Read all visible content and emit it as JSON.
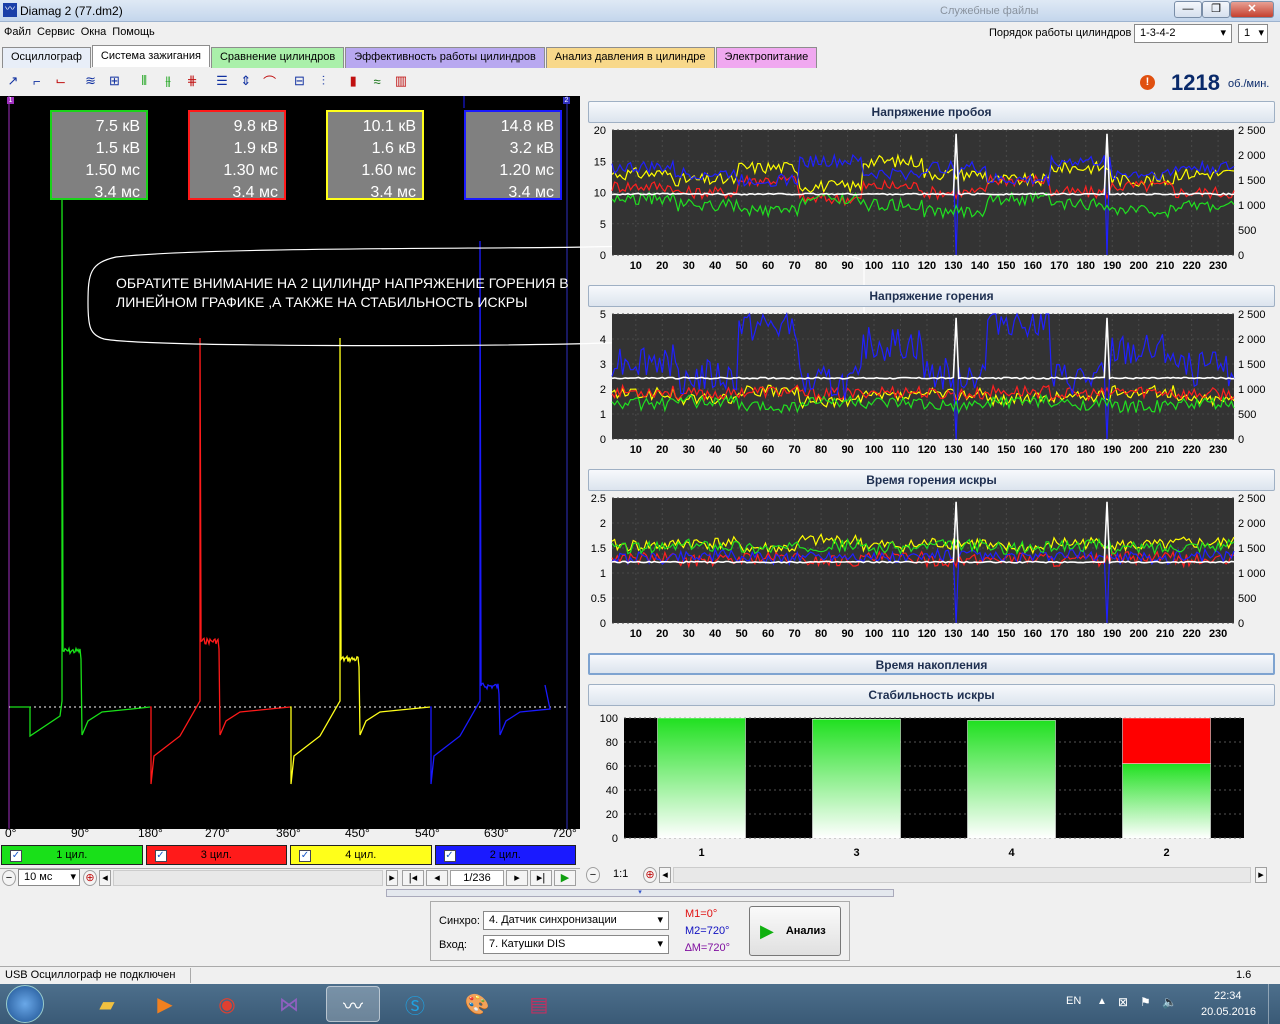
{
  "window": {
    "title": "Diamag 2 (77.dm2)",
    "ghost_tab": "Служебные файлы"
  },
  "menu": [
    "Файл",
    "Сервис",
    "Окна",
    "Помощь"
  ],
  "firing_order": {
    "label": "Порядок работы цилиндров",
    "value": "1-3-4-2",
    "spinner": "1"
  },
  "tabs": [
    {
      "label": "Осциллограф",
      "color": "#e8eef8"
    },
    {
      "label": "Система зажигания",
      "color": "#ffffff"
    },
    {
      "label": "Сравнение цилиндров",
      "color": "#aaf0aa"
    },
    {
      "label": "Эффективность работы цилиндров",
      "color": "#b8a8f0"
    },
    {
      "label": "Анализ давления в цилиндре",
      "color": "#f8d88a"
    },
    {
      "label": "Электропитание",
      "color": "#f0a8f0"
    }
  ],
  "rpm": {
    "value": "1218",
    "unit": "об./мин."
  },
  "readouts": [
    {
      "lines": [
        "7.5 кВ",
        "1.5 кВ",
        "1.50 мс",
        "3.4 мс"
      ],
      "color": "#19d419"
    },
    {
      "lines": [
        "9.8 кВ",
        "1.9 кВ",
        "1.30 мс",
        "3.4 мс"
      ],
      "color": "#ff1a1a"
    },
    {
      "lines": [
        "10.1 кВ",
        "1.6 кВ",
        "1.60 мс",
        "3.4 мс"
      ],
      "color": "#ffff1a"
    },
    {
      "lines": [
        "14.8 кВ",
        "3.2 кВ",
        "1.20 мс",
        "3.4 мс"
      ],
      "color": "#1a1aff"
    }
  ],
  "marker_labels": [
    "1",
    "2"
  ],
  "callout": "ОБРАТИТЕ ВНИМАНИЕ НА 2 ЦИЛИНДР НАПРЯЖЕНИЕ ГОРЕНИЯ В ЛИНЕЙНОМ ГРАФИКЕ ,А ТАКЖЕ НА СТАБИЛЬНОСТЬ ИСКРЫ",
  "deg_labels": [
    "0°",
    "90°",
    "180°",
    "270°",
    "360°",
    "450°",
    "540°",
    "630°",
    "720°"
  ],
  "cylinders": [
    {
      "label": "1 цил.",
      "color": "#19e019"
    },
    {
      "label": "3 цил.",
      "color": "#ff1a1a"
    },
    {
      "label": "4 цил.",
      "color": "#ffff1a"
    },
    {
      "label": "2 цил.",
      "color": "#1a1aff"
    }
  ],
  "nav": {
    "timebase": "10 мс",
    "frame": "1/236",
    "zoom": "1:1"
  },
  "panels": {
    "breakdown": "Напряжение пробоя",
    "burn_voltage": "Напряжение горения",
    "burn_time": "Время горения искры",
    "dwell": "Время накопления",
    "stability": "Стабильность искры"
  },
  "line_charts": {
    "x_ticks": [
      "10",
      "20",
      "30",
      "40",
      "50",
      "60",
      "70",
      "80",
      "90",
      "100",
      "110",
      "120",
      "130",
      "140",
      "150",
      "160",
      "170",
      "180",
      "190",
      "200",
      "210",
      "220",
      "230"
    ],
    "rpm_ticks": [
      "2 500",
      "2 000",
      "1 500",
      "1 000",
      "500",
      "0"
    ],
    "breakdown_y": [
      "20",
      "15",
      "10",
      "5",
      "0"
    ],
    "burn_voltage_y": [
      "5",
      "4",
      "3",
      "2",
      "1",
      "0"
    ],
    "burn_time_y": [
      "2.5",
      "2",
      "1.5",
      "1",
      "0.5",
      "0"
    ]
  },
  "chart_data": [
    {
      "type": "line",
      "title": "Напряжение пробоя",
      "x_range": [
        1,
        236
      ],
      "ylim": [
        0,
        20
      ],
      "y2lim": [
        0,
        2500
      ],
      "series": [
        {
          "values": [
            13,
            12,
            14,
            11,
            15,
            13,
            12,
            14,
            12,
            13
          ],
          "color": "#ffff00"
        },
        {
          "values": [
            11,
            10,
            12,
            9,
            11,
            10,
            12,
            10,
            11,
            10
          ],
          "color": "#ff2020"
        },
        {
          "values": [
            14,
            13,
            12,
            15,
            13,
            14,
            12,
            15,
            13,
            14
          ],
          "color": "#2020ff"
        },
        {
          "values": [
            9,
            8,
            7,
            9,
            8,
            7,
            9,
            8,
            7,
            8
          ],
          "color": "#20e020"
        },
        {
          "values": [
            1218,
            1218,
            1218,
            1218,
            1218,
            1218,
            1218,
            1218,
            1218,
            1218
          ],
          "color": "#ffffff",
          "axis": "rpm"
        }
      ]
    },
    {
      "type": "line",
      "title": "Напряжение горения",
      "x_range": [
        1,
        236
      ],
      "ylim": [
        0,
        5
      ],
      "y2lim": [
        0,
        2500
      ],
      "series": [
        {
          "values": [
            1.8,
            1.6,
            1.9,
            1.5,
            1.7,
            1.8,
            1.6,
            1.7,
            1.9,
            1.6
          ],
          "color": "#ffff00"
        },
        {
          "values": [
            1.9,
            1.8,
            1.9,
            1.8,
            1.9,
            1.8,
            1.9,
            1.8,
            1.9,
            1.8
          ],
          "color": "#ff2020"
        },
        {
          "values": [
            3.2,
            2.5,
            4.5,
            2.2,
            3.8,
            2.6,
            4.8,
            2.4,
            3.5,
            2.8
          ],
          "color": "#2020ff"
        },
        {
          "values": [
            1.4,
            1.5,
            1.3,
            1.5,
            1.4,
            1.3,
            1.5,
            1.4,
            1.3,
            1.4
          ],
          "color": "#20e020"
        },
        {
          "values": [
            1218,
            1218,
            1218,
            1218,
            1218,
            1218,
            1218,
            1218,
            1218,
            1218
          ],
          "color": "#ffffff",
          "axis": "rpm"
        }
      ]
    },
    {
      "type": "line",
      "title": "Время горения искры",
      "x_range": [
        1,
        236
      ],
      "ylim": [
        0,
        2.5
      ],
      "y2lim": [
        0,
        2500
      ],
      "series": [
        {
          "values": [
            1.55,
            1.6,
            1.5,
            1.65,
            1.55,
            1.6,
            1.5,
            1.6,
            1.55,
            1.6
          ],
          "color": "#ffff00"
        },
        {
          "values": [
            1.3,
            1.25,
            1.3,
            1.25,
            1.3,
            1.25,
            1.3,
            1.25,
            1.3,
            1.25
          ],
          "color": "#ff2020"
        },
        {
          "values": [
            1.3,
            1.35,
            1.3,
            1.35,
            1.3,
            1.35,
            1.3,
            1.35,
            1.3,
            1.35
          ],
          "color": "#2020ff"
        },
        {
          "values": [
            1.5,
            1.55,
            1.5,
            1.55,
            1.5,
            1.55,
            1.5,
            1.55,
            1.5,
            1.55
          ],
          "color": "#20e020"
        },
        {
          "values": [
            1218,
            1218,
            1218,
            1218,
            1218,
            1218,
            1218,
            1218,
            1218,
            1218
          ],
          "color": "#ffffff",
          "axis": "rpm"
        }
      ]
    },
    {
      "type": "bar",
      "title": "Стабильность искры",
      "categories": [
        "1",
        "3",
        "4",
        "2"
      ],
      "ylim": [
        0,
        100
      ],
      "y_ticks": [
        "100",
        "80",
        "60",
        "40",
        "20",
        "0"
      ],
      "series": [
        {
          "values": [
            100,
            99,
            98,
            62
          ],
          "color": "#20e020"
        },
        {
          "values": [
            0,
            0,
            0,
            38
          ],
          "color": "#ff0000"
        }
      ]
    }
  ],
  "sync": {
    "label": "Синхро:",
    "value": "4.  Датчик синхронизации"
  },
  "input": {
    "label": "Вход:",
    "value": "7.  Катушки DIS"
  },
  "markers": {
    "m1": "M1=0°",
    "m2": "M2=720°",
    "dm": "∆M=720°"
  },
  "analyze": "Анализ",
  "status": {
    "left": "USB Осциллограф не подключен",
    "right": "1.6"
  },
  "tray": {
    "lang": "EN",
    "time": "22:34",
    "date": "20.05.2016"
  }
}
